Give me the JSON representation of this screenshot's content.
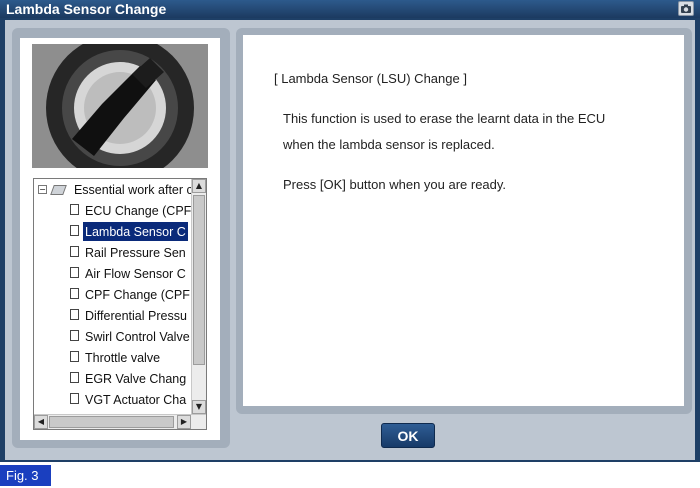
{
  "window": {
    "title": "Lambda Sensor Change",
    "camera_icon": "camera-icon"
  },
  "tree": {
    "root_label": "Essential work after c",
    "items": [
      {
        "label": "ECU Change (CPF"
      },
      {
        "label": "Lambda Sensor C",
        "selected": true
      },
      {
        "label": "Rail Pressure Sen"
      },
      {
        "label": "Air Flow Sensor C"
      },
      {
        "label": "CPF Change (CPF"
      },
      {
        "label": "Differential Pressu"
      },
      {
        "label": "Swirl Control Valve"
      },
      {
        "label": "Throttle valve"
      },
      {
        "label": "EGR Valve Chang"
      },
      {
        "label": "VGT Actuator Cha"
      }
    ]
  },
  "content": {
    "heading": "[ Lambda Sensor (LSU) Change ]",
    "line1": "This function is used to erase the learnt data in the ECU",
    "line2": "when the lambda sensor is replaced.",
    "line3": "Press [OK] button when you are ready."
  },
  "ok_button": "OK",
  "figure_label": "Fig. 3",
  "colors": {
    "frame": "#1e3f66",
    "selection": "#0a2a7a",
    "fig_label": "#1a3fbf"
  }
}
